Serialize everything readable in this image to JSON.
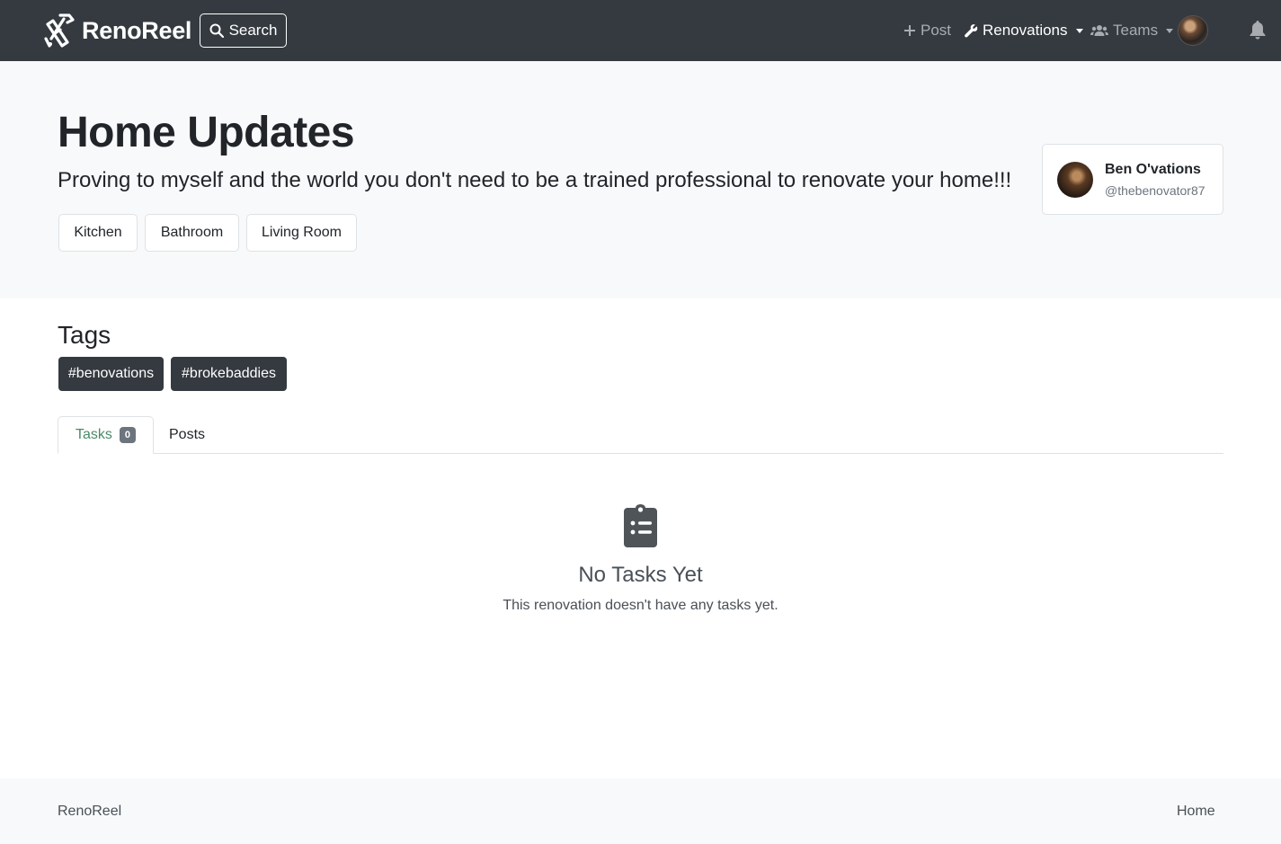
{
  "navbar": {
    "brand": "RenoReel",
    "search_label": "Search",
    "post_label": "Post",
    "renovations_label": "Renovations",
    "teams_label": "Teams"
  },
  "hero": {
    "title": "Home Updates",
    "subtitle": "Proving to myself and the world you don't need to be a trained professional to renovate your home!!!",
    "rooms": [
      "Kitchen",
      "Bathroom",
      "Living Room"
    ]
  },
  "owner": {
    "name": "Ben O'vations",
    "handle": "@thebenovator87"
  },
  "tags": {
    "heading": "Tags",
    "items": [
      "#benovations",
      "#brokebaddies"
    ]
  },
  "tabs": {
    "tasks_label": "Tasks",
    "tasks_count": "0",
    "posts_label": "Posts"
  },
  "empty_state": {
    "title": "No Tasks Yet",
    "text": "This renovation doesn't have any tasks yet."
  },
  "footer": {
    "brand": "RenoReel",
    "home_link": "Home"
  },
  "colors": {
    "navbar_bg": "#343a40",
    "hero_bg": "#f8f9fa",
    "tag_bg": "#343a40",
    "active_tab_text": "#4a8a6a",
    "badge_bg": "#6c757d"
  },
  "icons": {
    "logo": "tools-logo-icon",
    "search": "search-icon",
    "post": "plus-icon",
    "renovations": "wrench-icon",
    "teams": "users-icon",
    "notifications": "bell-icon",
    "empty_state": "clipboard-list-icon"
  }
}
